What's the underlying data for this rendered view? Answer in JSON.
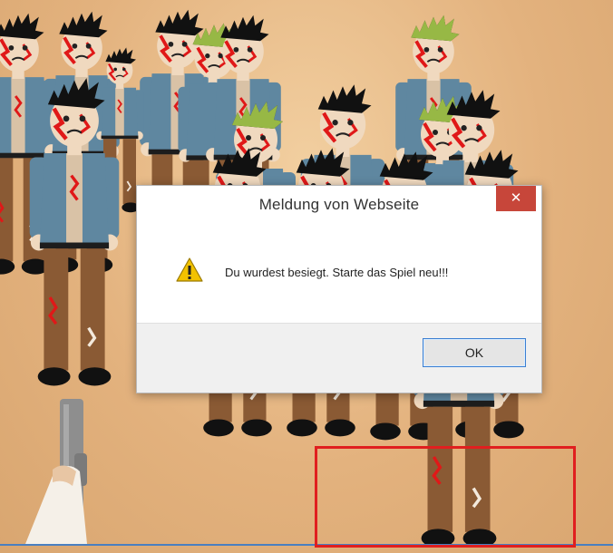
{
  "dialog": {
    "title": "Meldung von Webseite",
    "close_glyph": "✕",
    "message": "Du wurdest besiegt. Starte das Spiel neu!!!",
    "icon": "warning-icon",
    "ok_label": "OK"
  },
  "scene": {
    "background_color": "#e6b884",
    "zombie_count": 20,
    "weapon": "handgun",
    "highlight_color": "#e01f1f",
    "frame_line_color": "#4a7fc0"
  },
  "colors": {
    "jacket": "#5f87a0",
    "pants": "#8a5a34",
    "skin": "#f0d9bf",
    "hair_black": "#111111",
    "hair_green": "#97b845",
    "blood": "#e01818",
    "close_button": "#c7463a",
    "ok_border": "#3c7fd1"
  }
}
